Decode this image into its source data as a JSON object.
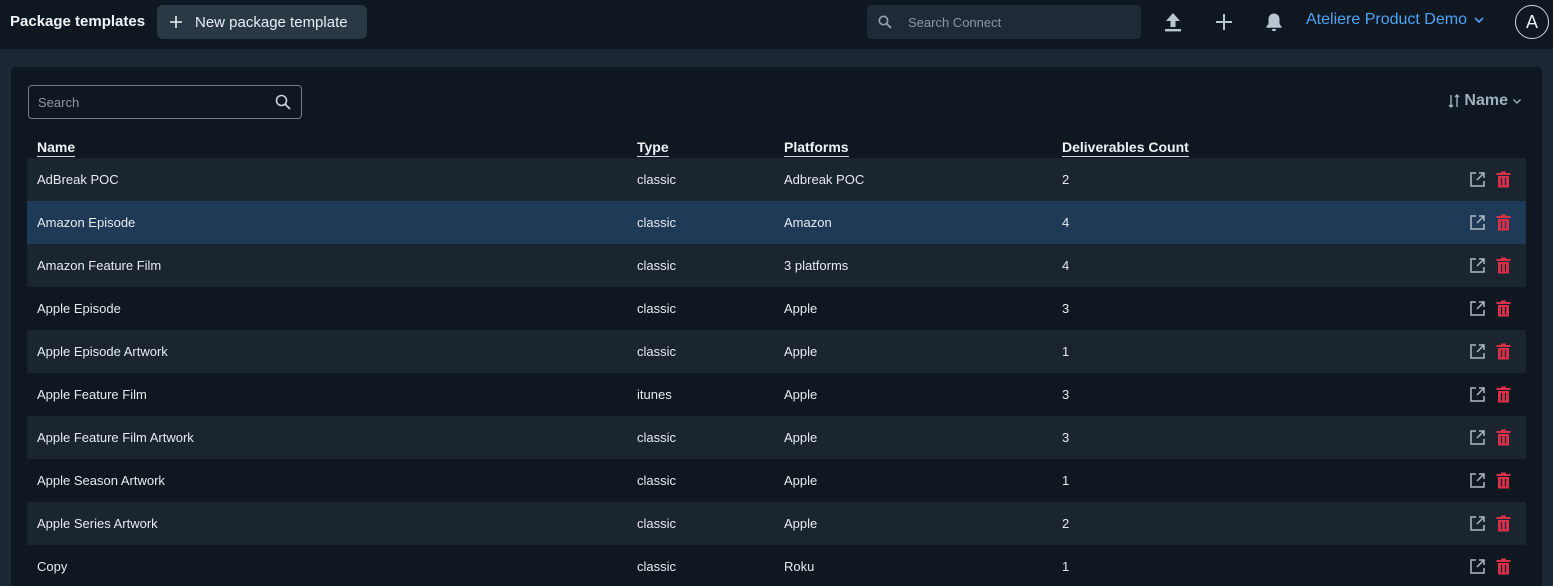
{
  "header": {
    "title": "Package templates",
    "new_button_label": "New package template",
    "search_placeholder": "Search Connect",
    "org_name": "Ateliere Product Demo",
    "avatar_initial": "A",
    "icons": [
      "upload-icon",
      "plus-icon",
      "bell-icon",
      "chevron-down-icon"
    ]
  },
  "toolbar": {
    "search_placeholder": "Search",
    "sort_label": "Name"
  },
  "table": {
    "columns": [
      "Name",
      "Type",
      "Platforms",
      "Deliverables Count"
    ],
    "rows": [
      {
        "name": "AdBreak POC",
        "type": "classic",
        "platforms": "Adbreak POC",
        "count": "2"
      },
      {
        "name": "Amazon Episode",
        "type": "classic",
        "platforms": "Amazon",
        "count": "4"
      },
      {
        "name": "Amazon Feature Film",
        "type": "classic",
        "platforms": "3 platforms",
        "count": "4"
      },
      {
        "name": "Apple Episode",
        "type": "classic",
        "platforms": "Apple",
        "count": "3"
      },
      {
        "name": "Apple Episode Artwork",
        "type": "classic",
        "platforms": "Apple",
        "count": "1"
      },
      {
        "name": "Apple Feature Film",
        "type": "itunes",
        "platforms": "Apple",
        "count": "3"
      },
      {
        "name": "Apple Feature Film Artwork",
        "type": "classic",
        "platforms": "Apple",
        "count": "3"
      },
      {
        "name": "Apple Season Artwork",
        "type": "classic",
        "platforms": "Apple",
        "count": "1"
      },
      {
        "name": "Apple Series Artwork",
        "type": "classic",
        "platforms": "Apple",
        "count": "2"
      },
      {
        "name": "Copy",
        "type": "classic",
        "platforms": "Roku",
        "count": "1"
      }
    ]
  },
  "colors": {
    "accent": "#4fa3f7",
    "delete": "#d9304a",
    "selected_row": "#1e3a57"
  }
}
